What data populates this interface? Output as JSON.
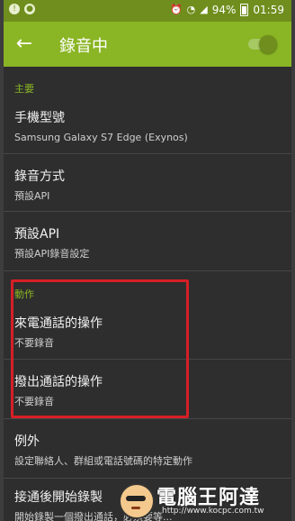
{
  "status_bar": {
    "battery": "94%",
    "time": "01:59"
  },
  "app_bar": {
    "back_glyph": "←",
    "title": "錄音中",
    "master_switch": "on"
  },
  "sections": {
    "main": {
      "header": "主要",
      "items": [
        {
          "title": "手機型號",
          "summary": "Samsung Galaxy S7 Edge (Exynos)"
        },
        {
          "title": "錄音方式",
          "summary": "預設API"
        },
        {
          "title": "預設API",
          "summary": "預設API錄音設定"
        }
      ]
    },
    "actions": {
      "header": "動作",
      "items": [
        {
          "title": "來電通話的操作",
          "summary": "不要錄音"
        },
        {
          "title": "撥出通話的操作",
          "summary": "不要錄音"
        }
      ]
    },
    "other": {
      "items": [
        {
          "title": "例外",
          "summary": "設定聯絡人、群組或電話號碼的特定動作"
        },
        {
          "title": "接通後開始錄製",
          "summary": "開始錄製一個撥出通話，必須要等..."
        }
      ]
    }
  },
  "watermark": {
    "brand": "電腦王阿達",
    "url": "http://www.kocpc.com.tw"
  },
  "colors": {
    "app_bar": "#8ab524",
    "status_bar": "#6f8e1d",
    "background": "#2e2e2e",
    "highlight_box": "#d61f26"
  }
}
